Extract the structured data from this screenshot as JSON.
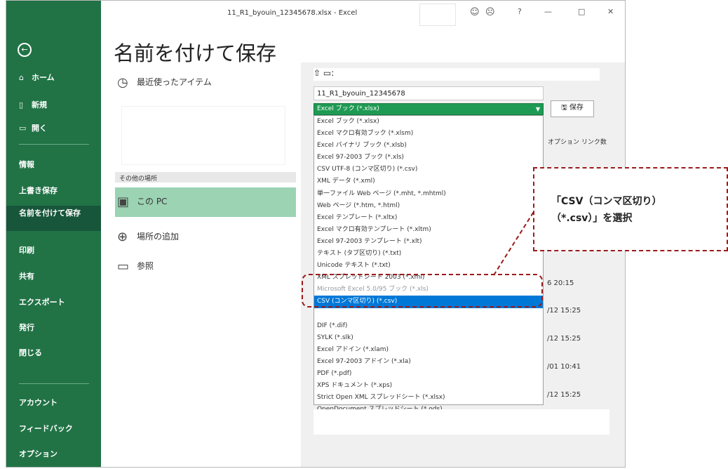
{
  "window": {
    "title": "11_R1_byouin_12345678.xlsx - Excel",
    "controls": [
      "☺",
      "☹",
      "?",
      "—",
      "□",
      "✕"
    ]
  },
  "sidebar": {
    "back_icon": "←",
    "top_items": [
      {
        "icon": "⌂",
        "label": "ホーム"
      },
      {
        "icon": "▯",
        "label": "新規"
      },
      {
        "icon": "▭",
        "label": "開く"
      }
    ],
    "items": [
      "情報",
      "上書き保存",
      "名前を付けて保存",
      "印刷",
      "共有",
      "エクスポート",
      "発行",
      "閉じる"
    ],
    "bottom_items": [
      "アカウント",
      "フィードバック",
      "オプション"
    ]
  },
  "page": {
    "title": "名前を付けて保存",
    "recent_label": "最近使ったアイテム",
    "other_locations": "その他の場所",
    "this_pc": "この PC",
    "add_place": "場所の追加",
    "browse": "参照"
  },
  "save": {
    "path": "⇧  ▭:",
    "filename": "11_R1_byouin_12345678",
    "filetype": "Excel ブック (*.xlsx)",
    "save_label": "保存",
    "options_label": "オプション リンク数"
  },
  "file_types": [
    "Excel ブック (*.xlsx)",
    "Excel マクロ有効ブック (*.xlsm)",
    "Excel バイナリ ブック (*.xlsb)",
    "Excel 97-2003 ブック (*.xls)",
    "CSV UTF-8 (コンマ区切り) (*.csv)",
    "XML データ (*.xml)",
    "単一ファイル Web ページ (*.mht, *.mhtml)",
    "Web ページ (*.htm, *.html)",
    "Excel テンプレート (*.xltx)",
    "Excel マクロ有効テンプレート (*.xltm)",
    "Excel 97-2003 テンプレート (*.xlt)",
    "テキスト (タブ区切り) (*.txt)",
    "Unicode テキスト (*.txt)",
    "XML スプレッドシート 2003 (*.xml)",
    "Microsoft Excel 5.0/95 ブック (*.xls)",
    "CSV (コンマ区切り) (*.csv)",
    "",
    "DIF (*.dif)",
    "SYLK (*.slk)",
    "Excel アドイン (*.xlam)",
    "Excel 97-2003 アドイン (*.xla)",
    "PDF (*.pdf)",
    "XPS ドキュメント (*.xps)",
    "Strict Open XML スプレッドシート (*.xlsx)",
    "OpenDocument スプレッドシート (*.ods)"
  ],
  "selected_type": "CSV (コンマ区切り) (*.csv)",
  "dates": [
    "6 20:15",
    "/12 15:25",
    "/12 15:25",
    "/01 10:41",
    "/12 15:25"
  ],
  "annotation": {
    "line1": "「CSV（コンマ区切り）",
    "line2": "（*.csv）」を選択"
  },
  "colors": {
    "accent": "#217346",
    "selected": "#0078d7",
    "annotation": "#9b1b1b"
  }
}
